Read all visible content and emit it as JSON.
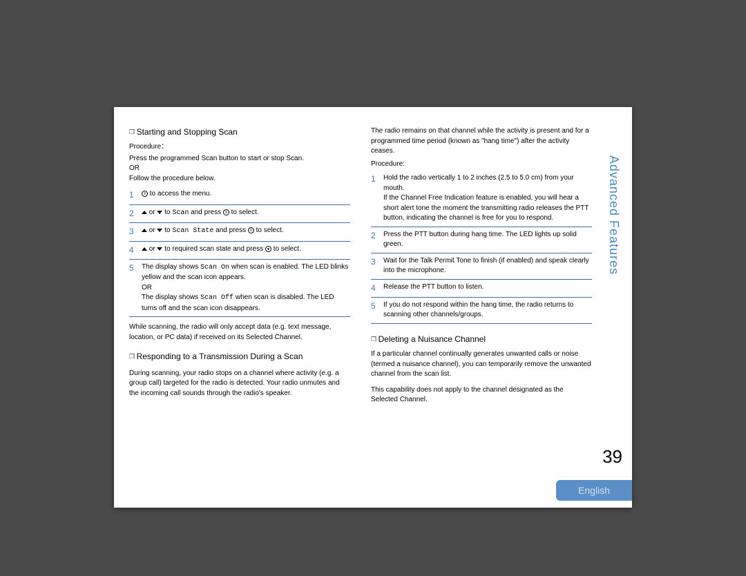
{
  "sidebar": {
    "title": "Advanced Features"
  },
  "page_number": "39",
  "language": "English",
  "left": {
    "heading1": "Starting and Stopping Scan",
    "procedure_label": "Procedure：",
    "intro_line1": "Press the programmed Scan  button to start or stop Scan.",
    "intro_or": "OR",
    "intro_line2": "Follow the procedure below.",
    "steps1": [
      {
        "n": "1",
        "body": "to access the menu."
      },
      {
        "n": "2",
        "body": "or",
        "body2": "to",
        "mono": "Scan",
        "body3": "and press",
        "body4": "to select."
      },
      {
        "n": "3",
        "body": "or",
        "body2": "to",
        "mono": "Scan State",
        "body3": "and press",
        "body4": "to select."
      },
      {
        "n": "4",
        "body": "or",
        "body2": "to required scan state and press",
        "body4": "to select."
      },
      {
        "n": "5",
        "body_pre": "The display shows",
        "mono1": "Scan On",
        "body_mid": "when scan is enabled. The LED blinks yellow and the scan icon appears.",
        "or": "OR",
        "body_pre2": "The display shows",
        "mono2": "Scan Off",
        "body_post": "when scan is disabled. The LED turns off and the scan icon disappears."
      }
    ],
    "note": "While scanning, the radio will only accept data (e.g. text message, location, or PC data) if received on its Selected Channel.",
    "heading2": "Responding to a Transmission During a Scan",
    "para2": "During scanning, your radio stops on a channel where activity (e.g. a group call) targeted for the radio is detected. Your radio unmutes and the incoming call sounds through the radio's speaker."
  },
  "right": {
    "intro": "The radio remains on that channel while the activity is present and for a programmed time period (known as \"hang time\") after the activity ceases.",
    "procedure_label": "Procedure:",
    "steps": [
      {
        "n": "1",
        "body": "Hold the radio vertically 1 to 2 inches (2.5 to 5.0 cm) from your mouth.",
        "extra": "If the Channel Free Indication feature is enabled, you will hear a short alert tone the moment the transmitting radio releases the PTT button, indicating the channel is free for you to respond."
      },
      {
        "n": "2",
        "body": "Press the PTT button during hang time. The LED lights up solid green."
      },
      {
        "n": "3",
        "body": "Wait for the Talk Permit Tone to finish (if enabled) and speak clearly into the microphone."
      },
      {
        "n": "4",
        "body": "Release the PTT button to listen."
      },
      {
        "n": "5",
        "body": "If you do not respond within the hang time, the radio returns to scanning other channels/groups."
      }
    ],
    "heading3": "Deleting a Nuisance Channel",
    "para3": "If a particular channel continually generates unwanted calls or noise (termed a  nuisance  channel), you can temporarily remove the unwanted channel from the scan list.",
    "para4": "This capability does not apply to the channel designated as the Selected Channel."
  }
}
